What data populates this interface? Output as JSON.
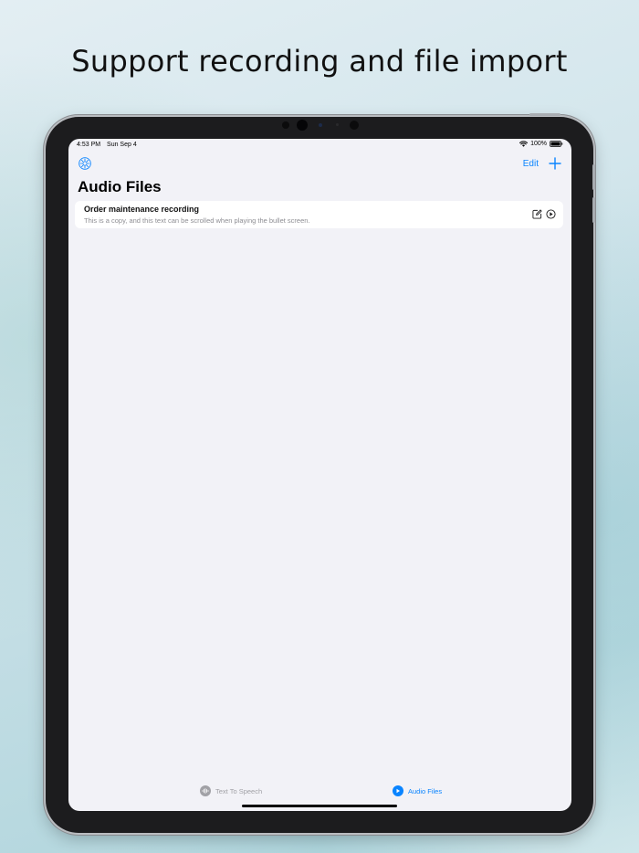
{
  "headline": "Support recording and file import",
  "status_bar": {
    "time": "4:53 PM",
    "date": "Sun Sep 4",
    "battery": "100%"
  },
  "nav": {
    "edit_label": "Edit"
  },
  "page_title": "Audio Files",
  "files": [
    {
      "title": "Order maintenance recording",
      "description": "This is a copy, and this text can be scrolled when playing the bullet screen."
    }
  ],
  "tabs": [
    {
      "label": "Text To Speech",
      "icon": "waveform-icon",
      "selected": false
    },
    {
      "label": "Audio Files",
      "icon": "play-circle-icon",
      "selected": true
    }
  ],
  "colors": {
    "accent": "#0a84ff",
    "tab_inactive": "#a1a1a6",
    "screen_background": "#f2f2f7"
  }
}
